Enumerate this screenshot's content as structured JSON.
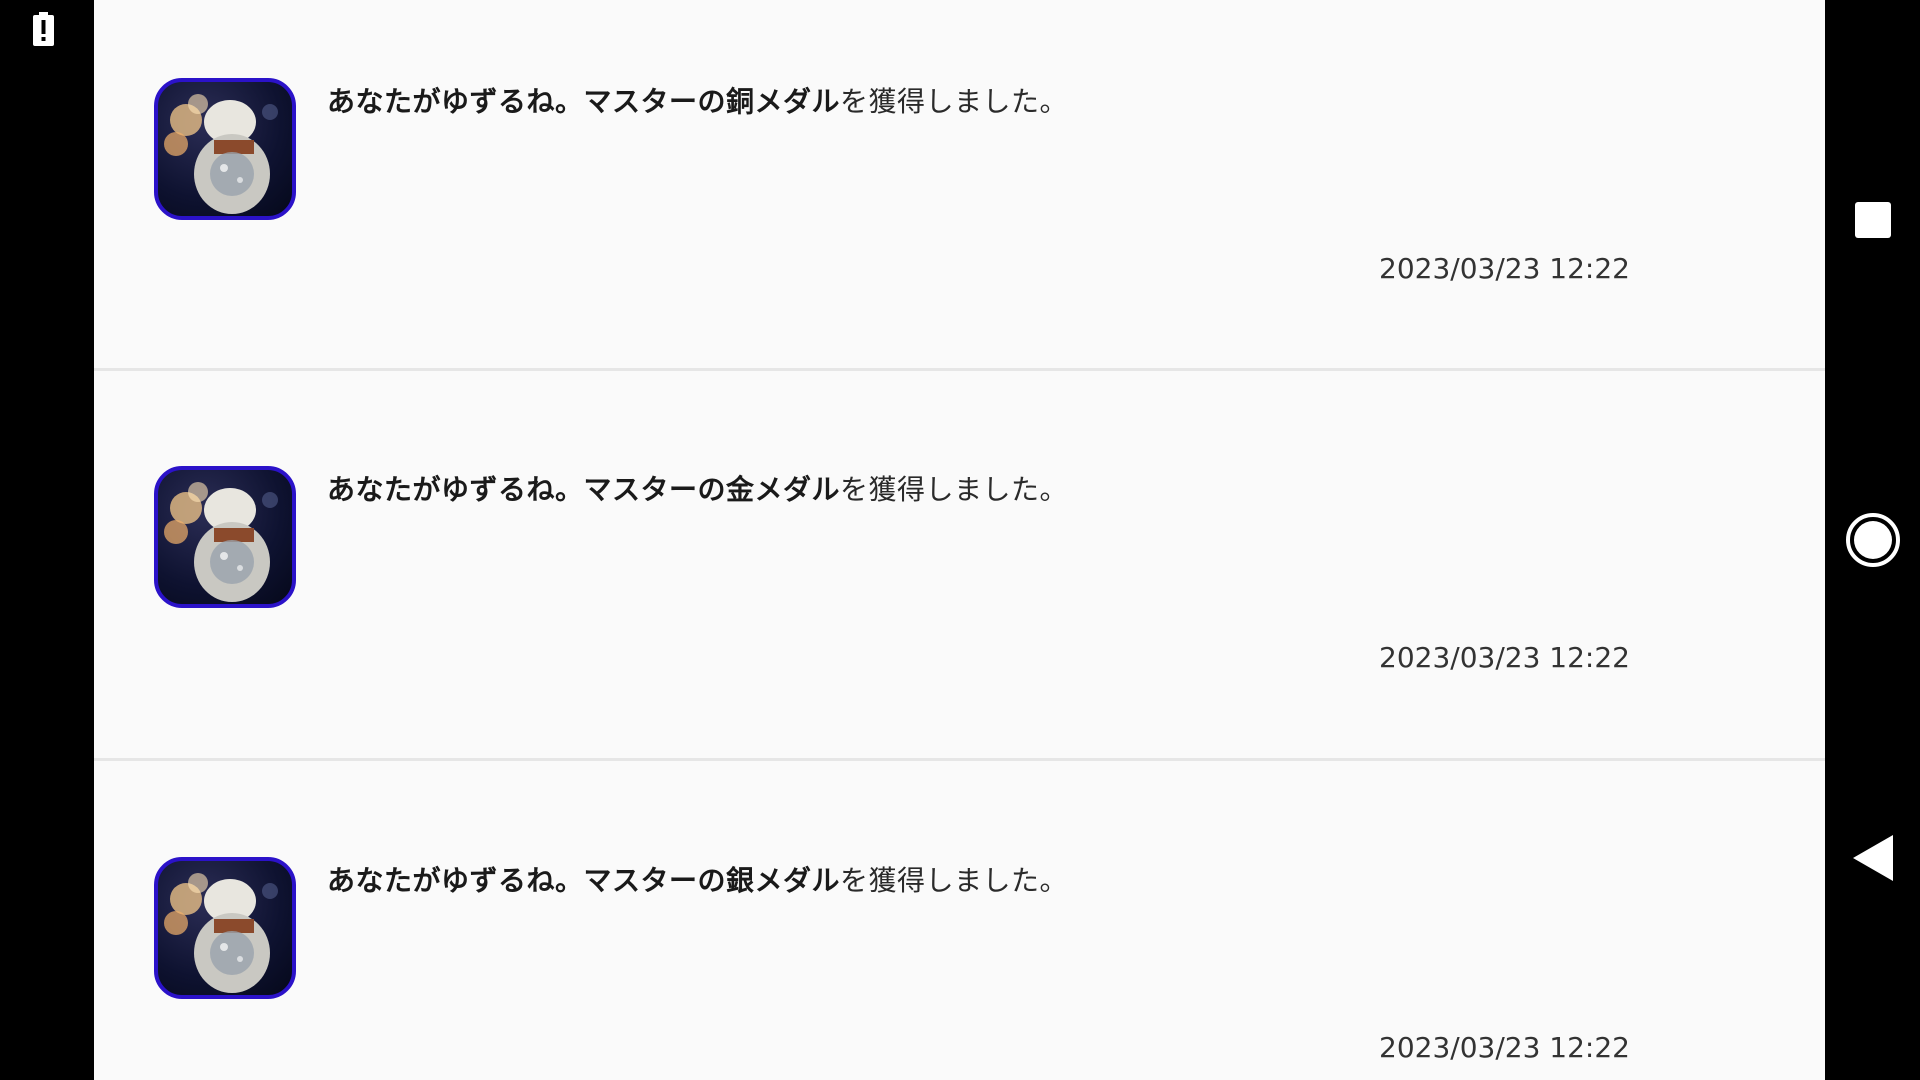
{
  "status_bar": {
    "left_icon": "battery-alert-icon"
  },
  "notifications": [
    {
      "avatar": "snowman-medal-avatar",
      "bold_text": "あなたがゆずるね。マスターの銅メダル",
      "normal_text": "を獲得しました。",
      "timestamp": "2023/03/23 12:22"
    },
    {
      "avatar": "snowman-medal-avatar",
      "bold_text": "あなたがゆずるね。マスターの金メダル",
      "normal_text": "を獲得しました。",
      "timestamp": "2023/03/23 12:22"
    },
    {
      "avatar": "snowman-medal-avatar",
      "bold_text": "あなたがゆずるね。マスターの銀メダル",
      "normal_text": "を獲得しました。",
      "timestamp": "2023/03/23 12:22"
    }
  ],
  "navigation": {
    "recents_icon": "square-recents-icon",
    "home_icon": "circle-home-icon",
    "back_icon": "triangle-back-icon"
  },
  "colors": {
    "avatar_border": "#2b12c9",
    "background": "#fafafa",
    "divider": "#e6e6e6"
  }
}
